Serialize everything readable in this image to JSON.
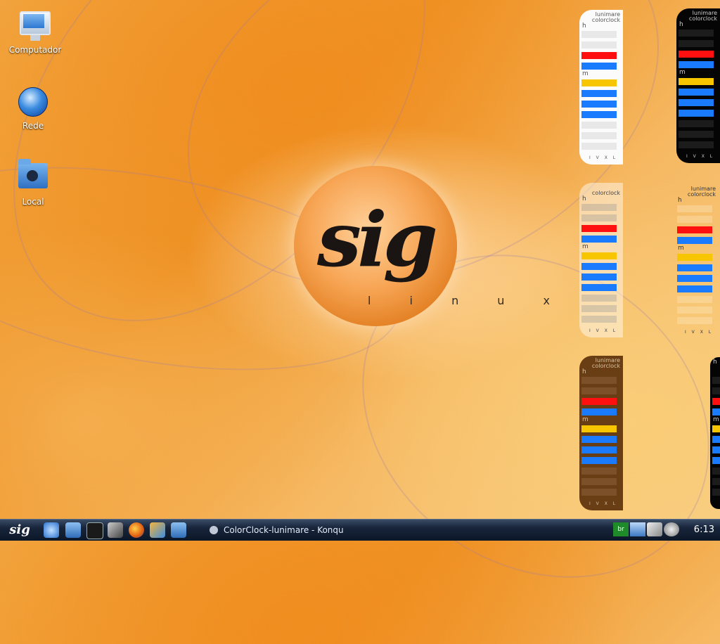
{
  "desktop": {
    "icons": [
      {
        "label": "Computador",
        "icon": "computer-icon"
      },
      {
        "label": "Rede",
        "icon": "network-globe-icon"
      },
      {
        "label": "Local",
        "icon": "home-folder-icon"
      }
    ],
    "logo": {
      "text": "sig",
      "subtitle": "l i n u x"
    }
  },
  "colorclock": {
    "title_line1": "lunimare",
    "title_line2": "colorclock",
    "hour_label": "h",
    "minute_label": "m",
    "footer": "I V X L",
    "colors": {
      "red": "#ff1010",
      "blue": "#1a7bff",
      "yellow": "#f7c600"
    }
  },
  "taskbar": {
    "start_label": "sig",
    "quicklaunch": [
      "kde-help-icon",
      "file-manager-icon",
      "terminal-icon",
      "settings-tools-icon",
      "firefox-icon",
      "multimedia-icon",
      "desktop-icon"
    ],
    "task_title": "ColorClock-lunimare - Konqu",
    "tray": [
      "keyboard-layout-br",
      "network-icon",
      "usb-icon",
      "power-icon"
    ],
    "keyboard_layout": "br",
    "clock": "6:13"
  }
}
